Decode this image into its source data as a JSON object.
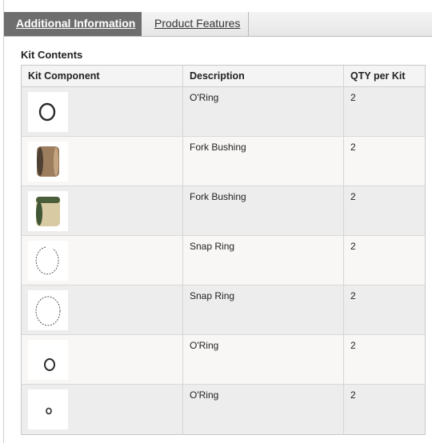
{
  "tabs": [
    {
      "label": "Additional Information",
      "active": true
    },
    {
      "label": "Product Features",
      "active": false
    }
  ],
  "section_title": "Kit Contents",
  "table": {
    "headers": [
      "Kit Component",
      "Description",
      "QTY per Kit"
    ],
    "rows": [
      {
        "icon": "o-ring-icon",
        "description": "O'Ring",
        "qty": "2"
      },
      {
        "icon": "fork-bushing-dark-icon",
        "description": "Fork Bushing",
        "qty": "2"
      },
      {
        "icon": "fork-bushing-green-icon",
        "description": "Fork Bushing",
        "qty": "2"
      },
      {
        "icon": "snap-ring-icon",
        "description": "Snap Ring",
        "qty": "2"
      },
      {
        "icon": "snap-ring-icon",
        "description": "Snap Ring",
        "qty": "2"
      },
      {
        "icon": "o-ring-small-icon",
        "description": "O'Ring",
        "qty": "2"
      },
      {
        "icon": "o-ring-tiny-icon",
        "description": "O'Ring",
        "qty": "2"
      }
    ]
  },
  "colors": {
    "active_tab_bg": "#6e6e6e",
    "row_odd_bg": "#eeeded",
    "row_even_bg": "#f8f7f5"
  }
}
